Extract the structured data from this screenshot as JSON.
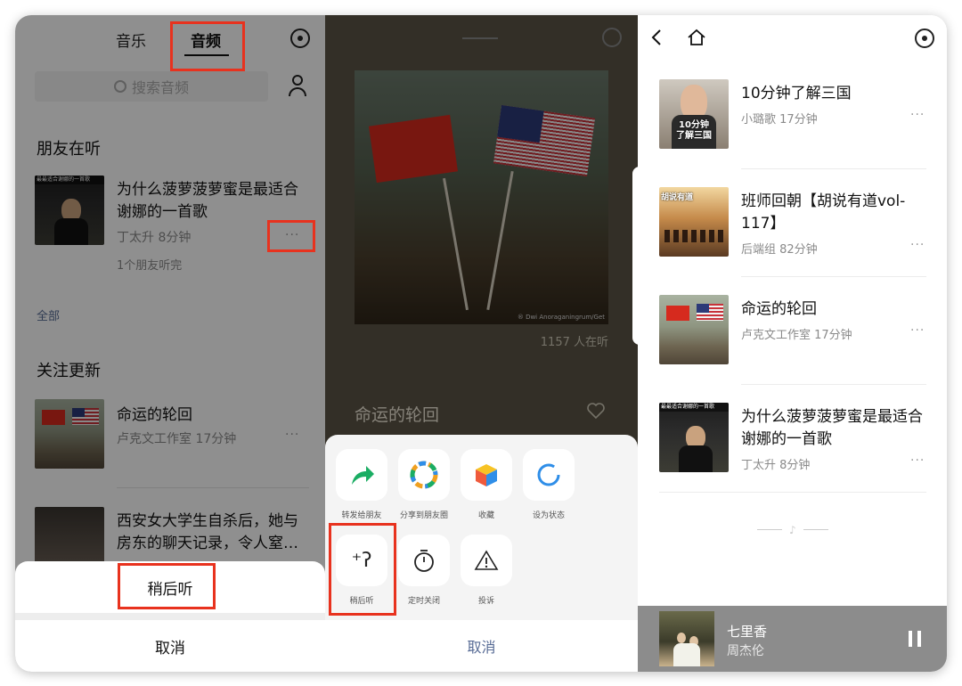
{
  "left": {
    "tabs": [
      "音乐",
      "音频"
    ],
    "search_placeholder": "搜索音频",
    "friends_heading": "朋友在听",
    "friend_item": {
      "thumb_text": "最最适合谢娜的一首歌",
      "title": "为什么菠萝菠萝蜜是最适合谢娜的一首歌",
      "meta": "丁太升 8分钟",
      "note": "1个朋友听完"
    },
    "all_link": "全部",
    "follow_heading": "关注更新",
    "follow_items": [
      {
        "title": "命运的轮回",
        "meta": "卢克文工作室 17分钟"
      },
      {
        "title": "西安女大学生自杀后，她与房东的聊天记录，令人窒…",
        "meta": ""
      }
    ],
    "sheet_action": "稍后听",
    "sheet_cancel": "取消"
  },
  "middle": {
    "listeners": "1157 人在听",
    "watermark": "® Dwi Anoraganingrum/Get",
    "track_title": "命运的轮回",
    "actions_row1": [
      {
        "label": "转发给朋友",
        "icon": "share-arrow-icon",
        "color": "#1aad63"
      },
      {
        "label": "分享到朋友圈",
        "icon": "moments-icon",
        "color": "#f0a020"
      },
      {
        "label": "收藏",
        "icon": "favorite-cube-icon",
        "color": "#2f8ee8"
      },
      {
        "label": "设为状态",
        "icon": "status-ring-icon",
        "color": "#2f8ee8"
      }
    ],
    "actions_row2": [
      {
        "label": "稍后听",
        "icon": "ear-listen-later-icon"
      },
      {
        "label": "定时关闭",
        "icon": "timer-icon"
      },
      {
        "label": "投诉",
        "icon": "warning-icon"
      }
    ],
    "cancel": "取消"
  },
  "right": {
    "items": [
      {
        "title": "10分钟了解三国",
        "meta": "小璐歌 17分钟",
        "thumb_text": "10分钟\n了解三国"
      },
      {
        "title": "班师回朝【胡说有道vol-117】",
        "meta": "后端组 82分钟",
        "thumb_text": "胡说有道"
      },
      {
        "title": "命运的轮回",
        "meta": "卢克文工作室 17分钟"
      },
      {
        "title": "为什么菠萝菠萝蜜是最适合谢娜的一首歌",
        "meta": "丁太升 8分钟",
        "thumb_text": "最最适合谢娜的一首歌"
      }
    ],
    "player": {
      "song": "七里香",
      "artist": "周杰伦"
    }
  },
  "colors": {
    "highlight": "#e8321e",
    "accent_blue": "#576b95",
    "player_bar": "#8c8c8c"
  }
}
